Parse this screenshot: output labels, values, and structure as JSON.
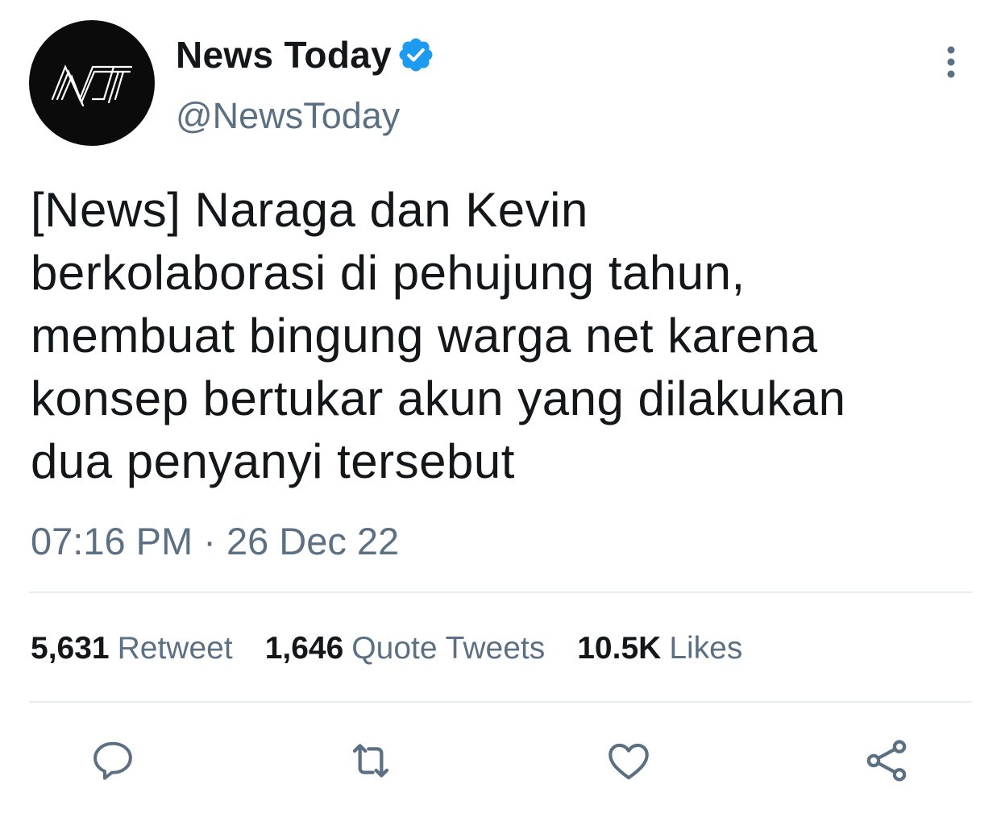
{
  "account": {
    "display_name": "News Today",
    "handle": "@NewsToday",
    "verified": true,
    "avatar_icon": "nt-logo-icon",
    "avatar_text": "NT"
  },
  "tweet": {
    "text": "[News] Naraga dan Kevin\nberkolaborasi di pehujung tahun,\nmembuat bingung warga net karena\nkonsep bertukar akun yang dilakukan\ndua penyanyi tersebut",
    "timestamp": "07:16 PM · 26 Dec 22"
  },
  "stats": {
    "retweets_count": "5,631",
    "retweets_label": "Retweet",
    "quotes_count": "1,646",
    "quotes_label": "Quote Tweets",
    "likes_count": "10.5K",
    "likes_label": "Likes"
  },
  "actions": [
    {
      "name": "reply",
      "icon": "comment-icon"
    },
    {
      "name": "retweet",
      "icon": "retweet-icon"
    },
    {
      "name": "like",
      "icon": "heart-icon"
    },
    {
      "name": "share",
      "icon": "share-icon"
    }
  ],
  "colors": {
    "text_primary": "#14171a",
    "text_secondary": "#5b7083",
    "verified_blue": "#1d9bf0",
    "divider": "#e6ecf0",
    "icon_gray": "#5b7083"
  }
}
